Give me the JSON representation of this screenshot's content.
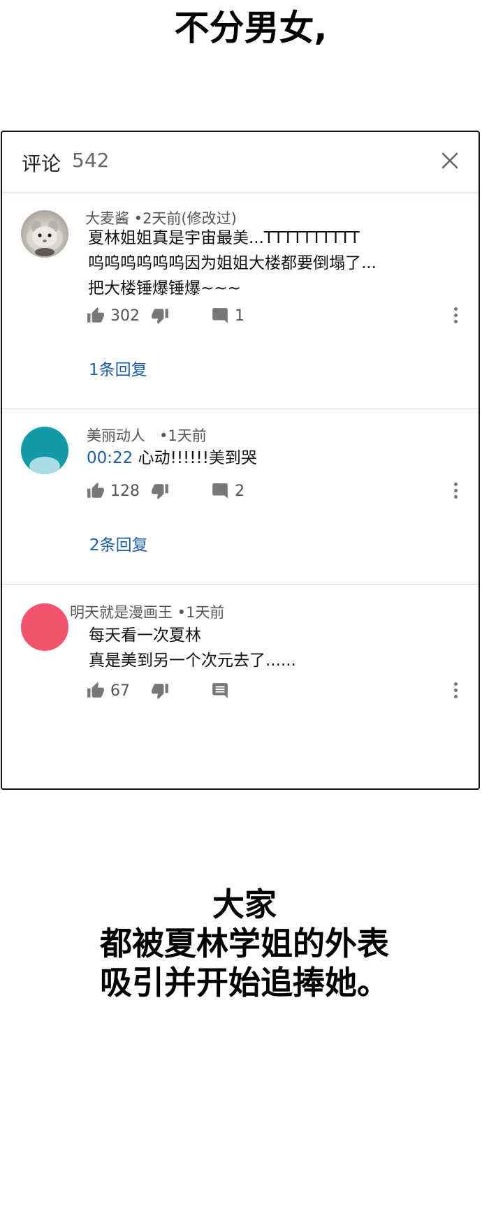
{
  "captions": {
    "top": "不分男女,",
    "bottom_lines": [
      "大家",
      "都被夏林学姐的外表",
      "吸引并开始追捧她。"
    ]
  },
  "comments_panel": {
    "title": "评论",
    "count": "542",
    "close_icon": "close-icon",
    "comments": [
      {
        "author": "大麦酱",
        "time": "2天前(修改过)",
        "avatar": "hamster-photo",
        "lines": [
          "夏林姐姐真是宇宙最美...TTTTTTTTTT",
          "呜呜呜呜呜呜因为姐姐大楼都要倒塌了...",
          "把大楼锤爆锤爆~~~"
        ],
        "likes": "302",
        "replies_count": "1",
        "replies_link": "1条回复"
      },
      {
        "author": "美丽动人",
        "time": "1天前",
        "avatar_color": "#129aa8",
        "timestamp_link": "00:22",
        "text": "心动!!!!!!美到哭",
        "likes": "128",
        "replies_count": "2",
        "replies_link": "2条回复"
      },
      {
        "author": "明天就是漫画王",
        "time": "1天前",
        "avatar_color": "#f2546d",
        "lines": [
          "每天看一次夏林",
          "真是美到另一个次元去了......"
        ],
        "likes": "67"
      }
    ]
  },
  "colors": {
    "link": "#1d5ea8",
    "icon_gray": "#777777",
    "border": "#111111"
  },
  "icons": {
    "like": "thumbs-up-icon",
    "dislike": "thumbs-down-icon",
    "reply": "comment-icon",
    "more": "more-vertical-icon"
  }
}
